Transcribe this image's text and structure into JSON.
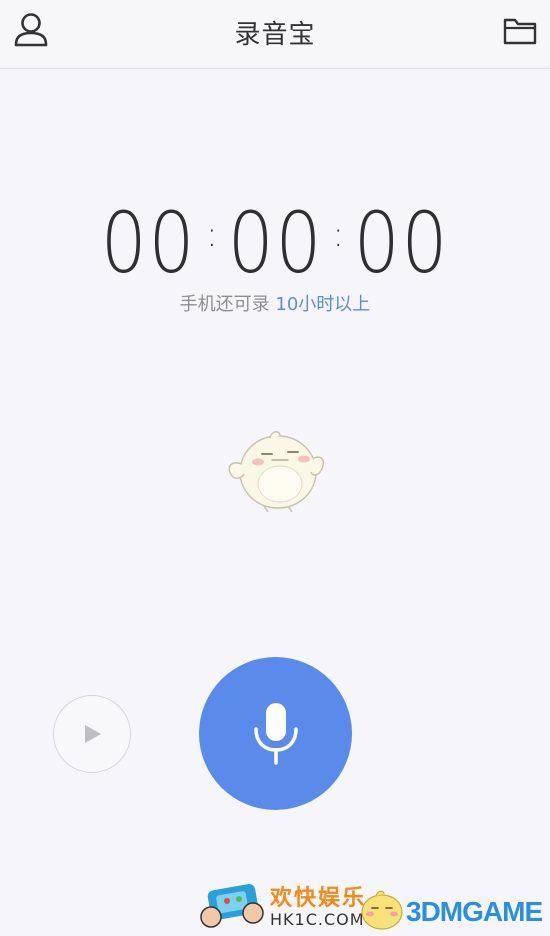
{
  "header": {
    "title": "录音宝",
    "left_icon": "user-icon",
    "right_icon": "folder-icon"
  },
  "timer": {
    "hours": "00",
    "minutes": "00",
    "seconds": "00",
    "separator": ":"
  },
  "remaining": {
    "prefix": "手机还可录 ",
    "highlight": "10小时以上"
  },
  "controls": {
    "play_icon": "play-icon",
    "record_icon": "microphone-icon"
  },
  "colors": {
    "accent": "#5a8bea",
    "highlight_text": "#5a8be6",
    "background": "#f6f6fa"
  },
  "watermark": {
    "cn_text": "欢快娱乐",
    "url": "HK1C.COM",
    "brand": "3DMGAME"
  }
}
